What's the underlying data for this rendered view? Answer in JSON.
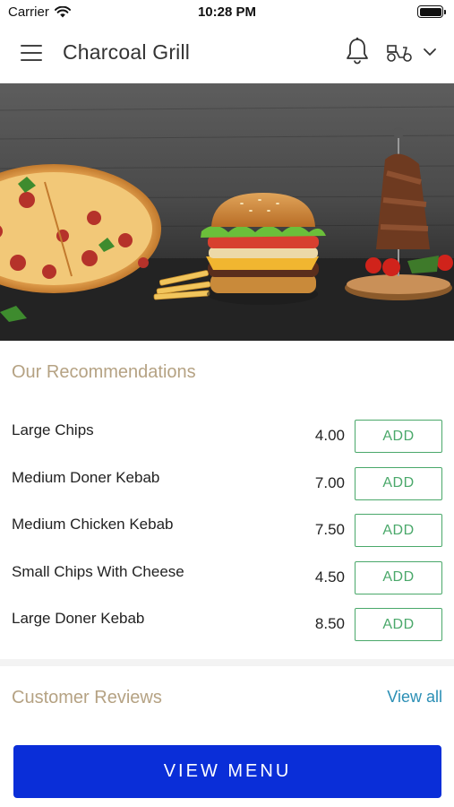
{
  "status_bar": {
    "carrier": "Carrier",
    "time": "10:28 PM"
  },
  "header": {
    "title": "Charcoal Grill",
    "icons": [
      "menu-icon",
      "bell-icon",
      "scooter-icon",
      "chevron-down-icon"
    ]
  },
  "hero": {
    "image": "food-banner-image",
    "depicts": [
      "pizza",
      "burger",
      "fries",
      "meat-skewers"
    ]
  },
  "recommendations": {
    "title": "Our Recommendations",
    "add_label": "ADD",
    "items": [
      {
        "name": "Large Chips",
        "price": "4.00"
      },
      {
        "name": "Medium Doner Kebab",
        "price": "7.00"
      },
      {
        "name": "Medium Chicken Kebab",
        "price": "7.50"
      },
      {
        "name": "Small Chips With Cheese",
        "price": "4.50"
      },
      {
        "name": "Large Doner Kebab",
        "price": "8.50"
      }
    ]
  },
  "reviews": {
    "title": "Customer Reviews",
    "view_all": "View all"
  },
  "footer": {
    "view_menu": "VIEW MENU"
  },
  "colors": {
    "accent_gold": "#b5a283",
    "add_green": "#4aa86a",
    "link_blue": "#2b8fb5",
    "button_blue": "#0a2ed8"
  }
}
